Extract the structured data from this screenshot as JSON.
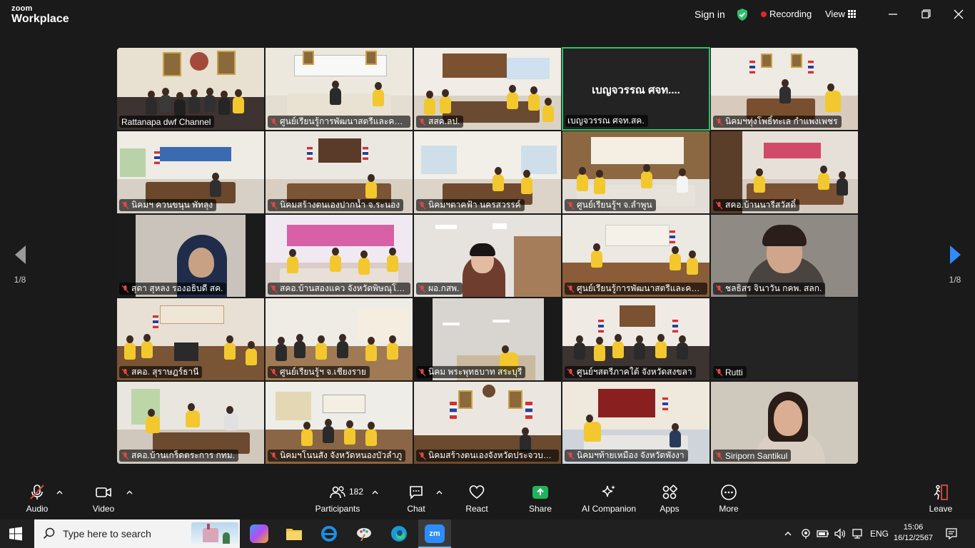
{
  "app": {
    "logo_line1": "zoom",
    "logo_line2": "Workplace"
  },
  "header": {
    "sign_in": "Sign in",
    "recording": "Recording",
    "view": "View"
  },
  "gallery": {
    "tiles": [
      {
        "name": "Rattanapa dwf Channel"
      },
      {
        "name": "ศูนย์เรียนรู้การพัฒนาสตรีและครอบ..."
      },
      {
        "name": "สสค.ลป."
      },
      {
        "name": "เบญจวรรณ ศจท.สค.",
        "center_text": "เบญจวรรณ ศจท...."
      },
      {
        "name": "นิคมฯทุ่งโพธิ์ทะเล กำแพงเพชร"
      },
      {
        "name": "นิคมฯ ควนขนุน พัทลุง"
      },
      {
        "name": "นิคมสร้างตนเองปากน้ำ จ.ระนอง"
      },
      {
        "name": "นิคมฯตาคฟ้า นครสวรรค์"
      },
      {
        "name": "ศูนย์เรียนรู้ฯ จ.ลำพูน"
      },
      {
        "name": "สคอ.บ้านนารีสวัสดิ์"
      },
      {
        "name": "สุดา สุหลง รองอธิบดี สค."
      },
      {
        "name": "สคอ.บ้านสองแคว จังหวัดพิษณุโลก"
      },
      {
        "name": "ผอ.กสพ."
      },
      {
        "name": "ศูนย์เรียนรู้การพัฒนาสตรีและครอบ..."
      },
      {
        "name": "ชลธิสร จินาวัน กคพ. สลก."
      },
      {
        "name": "สคอ. สุราษฎร์ธานี"
      },
      {
        "name": "ศูนย์เรียนรู้ฯ จ.เชียงราย"
      },
      {
        "name": "นิคม พระพุทธบาท สระบุรี"
      },
      {
        "name": "ศูนย์ฯสตรีภาคใต้ จังหวัดสงขลา"
      },
      {
        "name": "Rutti"
      },
      {
        "name": "สคอ.บ้านเกร็ดตระการ กทม."
      },
      {
        "name": "นิคมฯโนนสัง จังหวัดหนองบัวลำภู"
      },
      {
        "name": "นิคมสร้างตนเองจังหวัดประจวบคีรีขันธ์"
      },
      {
        "name": "นิคมฯท้ายเหมือง จังหวัดพังงา"
      },
      {
        "name": "Siriporn Santikul"
      }
    ]
  },
  "nav": {
    "left_page": "1/8",
    "right_page": "1/8"
  },
  "toolbar": {
    "audio": "Audio",
    "video": "Video",
    "participants": "Participants",
    "participants_count": "182",
    "chat": "Chat",
    "react": "React",
    "share": "Share",
    "ai_companion": "AI Companion",
    "apps": "Apps",
    "more": "More",
    "leave": "Leave"
  },
  "taskbar": {
    "search_placeholder": "Type here to search",
    "language": "ENG",
    "time": "15:06",
    "date": "16/12/2567"
  },
  "colors": {
    "active_speaker": "#2fbf6a",
    "recording": "#e02828",
    "share": "#1fb35a"
  }
}
